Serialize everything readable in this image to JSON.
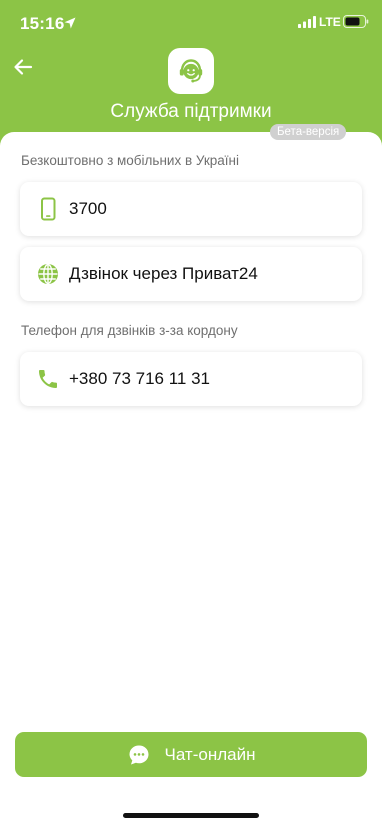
{
  "status_bar": {
    "time": "15:16",
    "network": "LTE"
  },
  "header": {
    "title": "Служба підтримки",
    "beta_badge": "Бета-версія"
  },
  "sections": [
    {
      "label": "Безкоштовно з мобільних в Україні",
      "items": [
        {
          "icon": "phone-icon",
          "label": "3700"
        },
        {
          "icon": "globe-icon",
          "label": "Дзвінок через Приват24"
        }
      ]
    },
    {
      "label": "Телефон для дзвінків з-за кордону",
      "items": [
        {
          "icon": "handset-icon",
          "label": "+380 73 716 11 31"
        }
      ]
    }
  ],
  "chat_button": {
    "label": "Чат-онлайн",
    "icon": "chat-icon"
  },
  "colors": {
    "brand_green": "#8cc446",
    "label_grey": "#6f6f6f",
    "badge_grey": "#d0d0d0"
  }
}
